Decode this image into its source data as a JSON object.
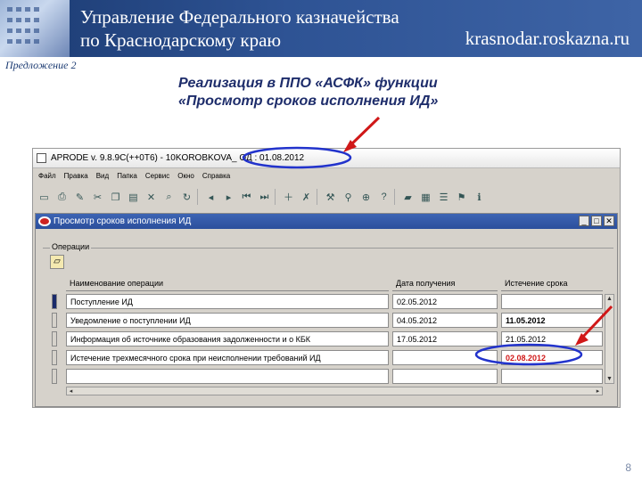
{
  "banner": {
    "title_line1": "Управление Федерального казначейства",
    "title_line2": "по Краснодарскому краю",
    "site": "krasnodar.roskazna.ru"
  },
  "proposal_label": "Предложение 2",
  "slide_title": {
    "line1": "Реализация в ППО «АСФК» функции",
    "line2": "«Просмотр сроков исполнения ИД»"
  },
  "app": {
    "title": "APRODE v. 9.8.9C(++0T6) - 10KOROBKOVA_ ОД : 01.08.2012",
    "menu": [
      "Файл",
      "Правка",
      "Вид",
      "Папка",
      "Сервис",
      "Окно",
      "Справка"
    ],
    "toolbar_icons": [
      "save-icon",
      "print-icon",
      "edit-icon",
      "cut-icon",
      "copy-icon",
      "paste-icon",
      "clear-icon",
      "find-icon",
      "refresh-icon",
      "sep",
      "prev-icon",
      "next-icon",
      "first-icon",
      "last-icon",
      "sep",
      "insert-icon",
      "delete-icon",
      "sep",
      "tools-icon",
      "attach-icon",
      "zoom-icon",
      "help-icon",
      "sep",
      "folder-icon",
      "report-icon",
      "list-icon",
      "flag-icon",
      "info-icon"
    ]
  },
  "form": {
    "title": "Просмотр сроков исполнения ИД",
    "group_label": "Операции",
    "columns": {
      "operation": "Наименование операции",
      "received": "Дата получения",
      "expiry": "Истечение срока"
    },
    "rows": [
      {
        "operation": "Поступление ИД",
        "received": "02.05.2012",
        "expiry": ""
      },
      {
        "operation": "Уведомление о поступлении ИД",
        "received": "04.05.2012",
        "expiry": "11.05.2012"
      },
      {
        "operation": "Информация об источнике образования задолженности и о КБК",
        "received": "17.05.2012",
        "expiry": "21.05.2012"
      },
      {
        "operation": "Истечение трехмесячного срока при неисполнении требований ИД",
        "received": "",
        "expiry": "02.08.2012"
      },
      {
        "operation": "",
        "received": "",
        "expiry": ""
      }
    ]
  },
  "page_number": "8"
}
